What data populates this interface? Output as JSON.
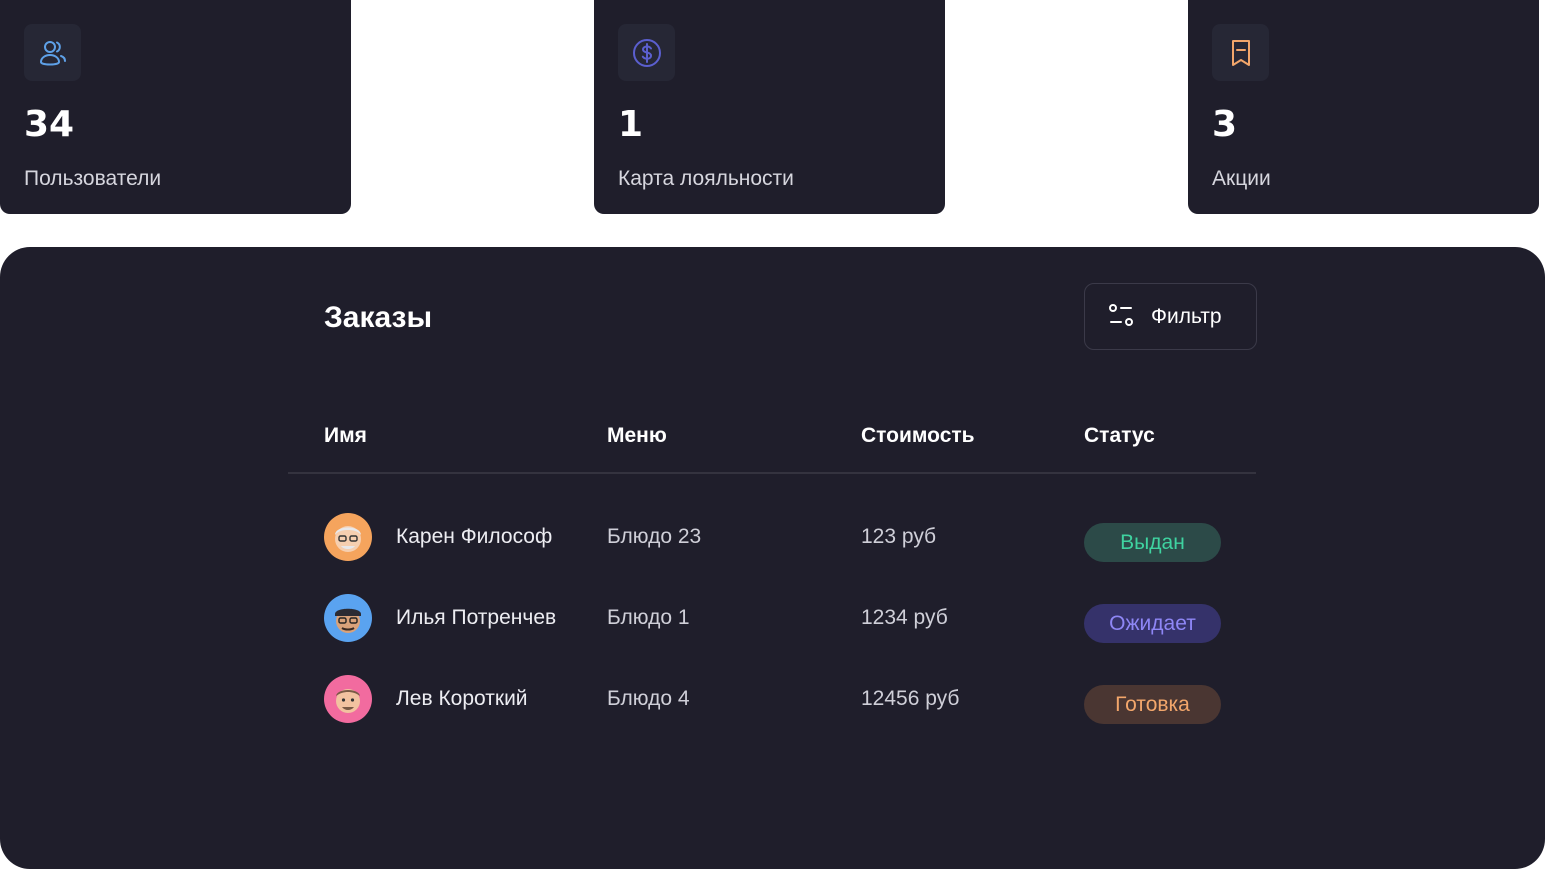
{
  "stats": [
    {
      "value": "34",
      "label": "Пользователи",
      "icon": "users-icon",
      "icon_color": "#5ea1e8"
    },
    {
      "value": "1",
      "label": "Карта лояльности",
      "icon": "dollar-coin-icon",
      "icon_color": "#5b5fcf"
    },
    {
      "value": "3",
      "label": "Акции",
      "icon": "receipt-icon",
      "icon_color": "#f2a66b"
    }
  ],
  "orders": {
    "title": "Заказы",
    "filter_label": "Фильтр",
    "columns": {
      "name": "Имя",
      "menu": "Меню",
      "cost": "Стоимость",
      "status": "Статус"
    },
    "rows": [
      {
        "name": "Карен Философ",
        "menu": "Блюдо 23",
        "cost": "123 руб",
        "status": "Выдан",
        "status_color": "#3fd3a0",
        "status_bg": "#2c4a48",
        "avatar_color": "#f5a45d"
      },
      {
        "name": "Илья Потренчев",
        "menu": "Блюдо 1",
        "cost": "1234 руб",
        "status": "Ожидает",
        "status_color": "#8e86f5",
        "status_bg": "#35326a",
        "avatar_color": "#5aa3f0"
      },
      {
        "name": "Лев Короткий",
        "menu": "Блюдо 4",
        "cost": "12456 руб",
        "status": "Готовка",
        "status_color": "#f2a66b",
        "status_bg": "#4a3632",
        "avatar_color": "#f26b9f"
      }
    ]
  },
  "colors": {
    "card_bg": "#1f1e2b",
    "icon_box_bg": "#262735",
    "page_bg": "#ffffff"
  }
}
